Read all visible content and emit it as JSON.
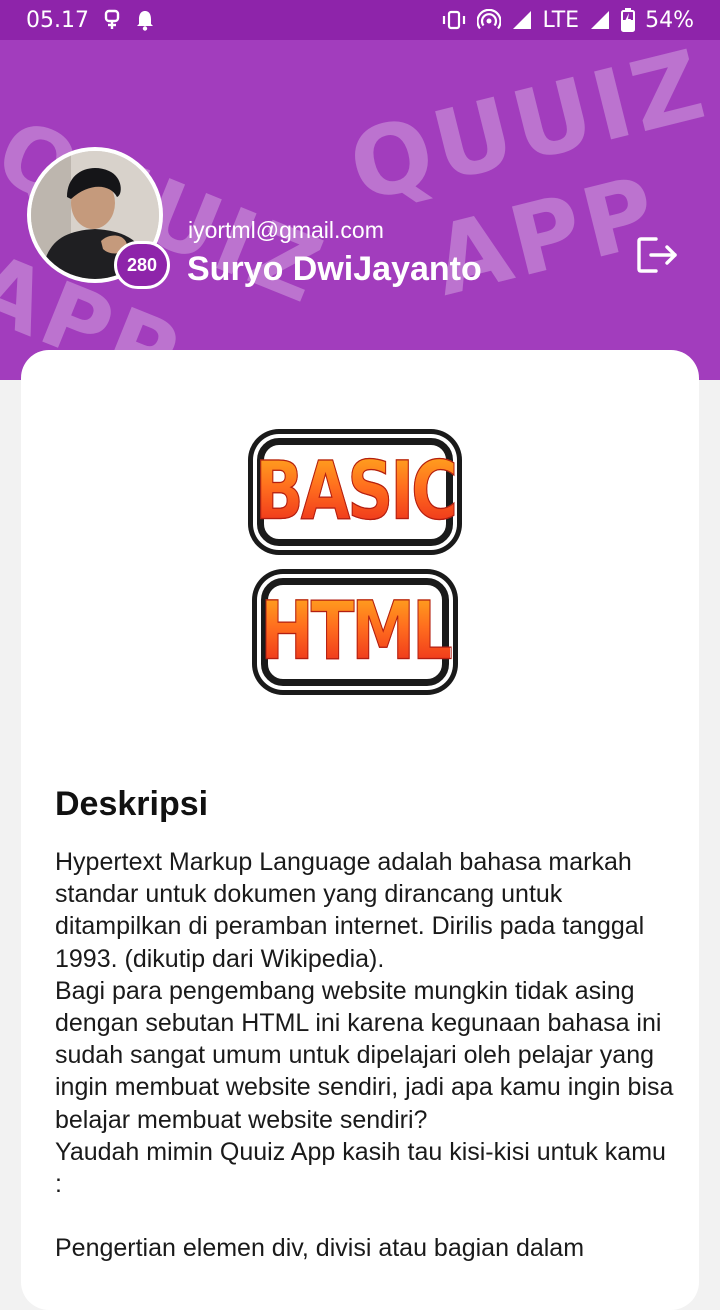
{
  "status_bar": {
    "time": "05.17",
    "network": "LTE",
    "battery": "54%"
  },
  "header": {
    "watermark_text": "QUUIZ APP",
    "watermark_lines": [
      "QUUIZ",
      "APP"
    ],
    "email": "iyortml@gmail.com",
    "name": "Suryo DwiJayanto",
    "score": "280"
  },
  "course": {
    "logo_line1": "BASIC",
    "logo_line2": "HTML",
    "section_title": "Deskripsi",
    "description": "Hypertext Markup Language adalah bahasa markah standar untuk dokumen yang dirancang untuk ditampilkan di peramban internet. Dirilis pada tanggal 1993. (dikutip dari Wikipedia).\nBagi para pengembang website mungkin tidak asing dengan sebutan HTML ini karena kegunaan bahasa ini sudah sangat umum untuk dipelajari oleh pelajar yang ingin membuat website sendiri, jadi apa kamu ingin bisa belajar membuat website sendiri?\nYaudah mimin Quuiz App kasih tau kisi-kisi untuk kamu :\n\nPengertian elemen div, divisi atau bagian dalam"
  },
  "colors": {
    "primary": "#8e24aa",
    "header_bg": "#a23dbd",
    "card_bg": "#ffffff",
    "page_bg": "#f2f2f2"
  },
  "icons": [
    "usb-icon",
    "notification-bell-icon",
    "vibrate-icon",
    "hotspot-icon",
    "signal-icon",
    "battery-charging-icon",
    "logout-icon"
  ]
}
